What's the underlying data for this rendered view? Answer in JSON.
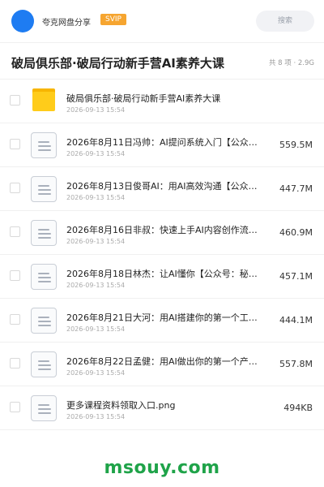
{
  "header": {
    "app_name": "夸克网盘分享",
    "badge": "SVIP",
    "search_placeholder": "搜索"
  },
  "title_bar": {
    "title": "破局俱乐部·破局行动新手营AI素养大课",
    "count": "共 8 项 · 2.9G"
  },
  "files": [
    {
      "name": "破局俱乐部·破局行动新手营AI素养大课",
      "date": "2026-09-13 15:54",
      "size": "",
      "type": "folder"
    },
    {
      "name": "2026年8月11日冯帅：AI提问系统入门【公众号…",
      "date": "2026-09-13 15:54",
      "size": "559.5M",
      "type": "file"
    },
    {
      "name": "2026年8月13日俊哥AI：用AI高效沟通【公众…",
      "date": "2026-09-13 15:54",
      "size": "447.7M",
      "type": "file"
    },
    {
      "name": "2026年8月16日非叔：快速上手AI内容创作流程…",
      "date": "2026-09-13 15:54",
      "size": "460.9M",
      "type": "file"
    },
    {
      "name": "2026年8月18日林杰：让AI懂你【公众号：秘知…",
      "date": "2026-09-13 15:54",
      "size": "457.1M",
      "type": "file"
    },
    {
      "name": "2026年8月21日大河：用AI搭建你的第一个工作…",
      "date": "2026-09-13 15:54",
      "size": "444.1M",
      "type": "file"
    },
    {
      "name": "2026年8月22日孟健：用AI做出你的第一个产品…",
      "date": "2026-09-13 15:54",
      "size": "557.8M",
      "type": "file"
    },
    {
      "name": "更多课程资料领取入口.png",
      "date": "2026-09-13 15:54",
      "size": "494KB",
      "type": "file"
    }
  ],
  "watermark": "msouy.com",
  "colors": {
    "avatar": "#1e7cf2",
    "badge": "#f6a530",
    "folder": "#ffcc1a",
    "watermark": "#1fa349"
  },
  "icons": {
    "folder": "folder-icon",
    "file": "document-icon"
  }
}
